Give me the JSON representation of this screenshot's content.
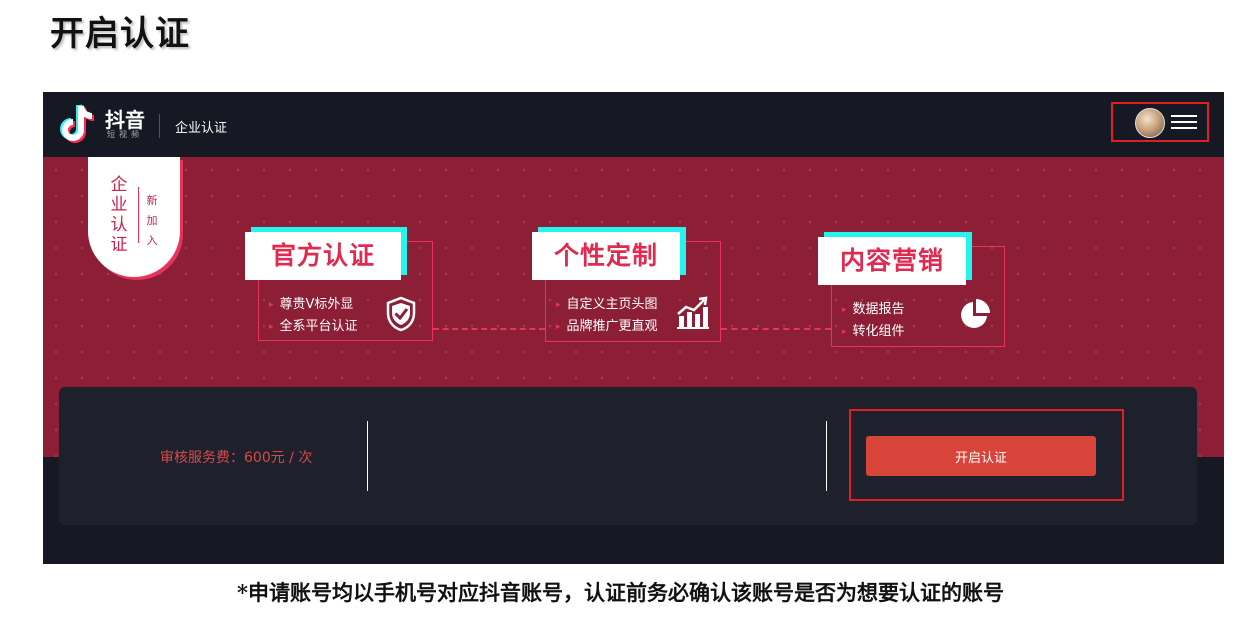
{
  "page": {
    "title": "开启认证"
  },
  "header": {
    "logo_text": "抖音",
    "logo_sub": "短视频",
    "nav_title": "企业认证"
  },
  "banner": {
    "tag_main": "企业认证",
    "tag_sub": "新加入",
    "features": [
      {
        "title": "官方认证",
        "items": [
          "尊贵V标外显",
          "全系平台认证"
        ],
        "icon": "shield-check-icon"
      },
      {
        "title": "个性定制",
        "items": [
          "自定义主页头图",
          "品牌推广更直观"
        ],
        "icon": "growth-chart-icon"
      },
      {
        "title": "内容营销",
        "items": [
          "数据报告",
          "转化组件"
        ],
        "icon": "pie-chart-icon"
      }
    ]
  },
  "fee": {
    "label": "审核服务费：600元 / 次",
    "button_label": "开启认证"
  },
  "footnote": "*申请账号均以手机号对应抖音账号，认证前务必确认该账号是否为想要认证的账号",
  "colors": {
    "dark_bg": "#161823",
    "banner_bg": "#8c1f36",
    "accent_pink": "#e8345a",
    "accent_cyan": "#25f4ee",
    "button_red": "#d8443a",
    "highlight_red": "#e02020"
  }
}
